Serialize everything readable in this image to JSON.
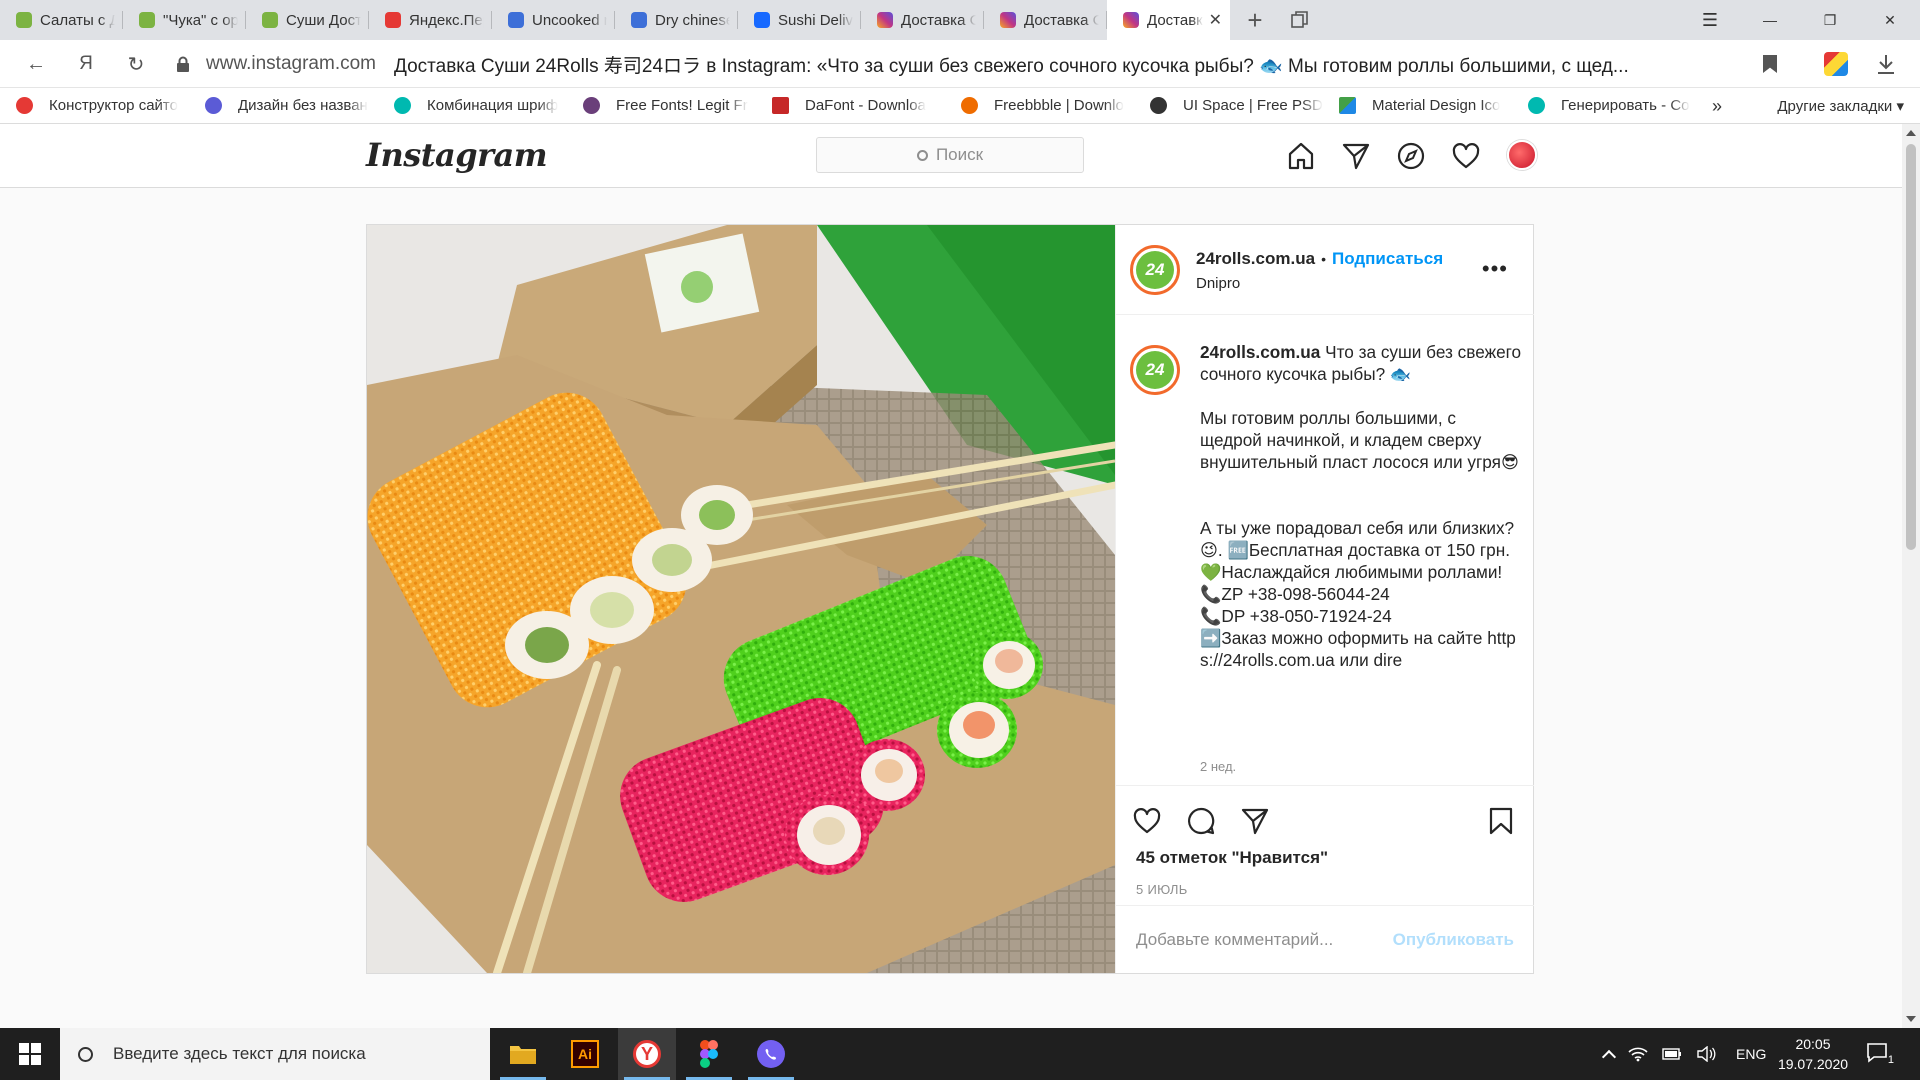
{
  "browser": {
    "tabs": [
      {
        "title": "Салаты с Дос",
        "color": "#7cb342"
      },
      {
        "title": "\"Чука\" с орех",
        "color": "#7cb342"
      },
      {
        "title": "Суши Достав",
        "color": "#7cb342"
      },
      {
        "title": "Яндекс.Перев",
        "color": "#e53935"
      },
      {
        "title": "Uncooked nes",
        "color": "#3d6fd8"
      },
      {
        "title": "Dry chinese n",
        "color": "#3d6fd8"
      },
      {
        "title": "Sushi Delivery",
        "color": "#1769ff"
      },
      {
        "title": "Доставка Сус",
        "color": "#c13584"
      },
      {
        "title": "Доставка Сус",
        "color": "#c13584"
      },
      {
        "title": "Доставка С",
        "color": "#c13584"
      }
    ],
    "tab_close": "✕",
    "new_tab": "+",
    "window": {
      "minimize": "—",
      "restore": "❐",
      "close": "✕",
      "menu": "☰"
    },
    "nav": {
      "back": "←",
      "yandex": "Я",
      "reload": "↻"
    },
    "address": {
      "host": "www.instagram.com",
      "title": "Доставка Суши 24Rolls 寿司24ロラ в Instagram: «Что за суши без свежего сочного кусочка рыбы? 🐟   Мы готовим роллы большими, с щед..."
    },
    "bookmarks": [
      {
        "label": "Конструктор сайто",
        "color": "#e53935"
      },
      {
        "label": "Дизайн без назван",
        "color": "#5b5bd6"
      },
      {
        "label": "Комбинация шриф",
        "color": "#00b9b0"
      },
      {
        "label": "Free Fonts! Legit Fr",
        "color": "#6a3f7a"
      },
      {
        "label": "DaFont - Downloa",
        "color": "#c62828"
      },
      {
        "label": "Freebbble | Downlo",
        "color": "#ef6c00"
      },
      {
        "label": "UI Space | Free PSD",
        "color": "#333333"
      },
      {
        "label": "Material Design Ico",
        "color": "#43a047"
      },
      {
        "label": "Генерировать - Co",
        "color": "#00b9b0"
      }
    ],
    "bookmarks_more": "»",
    "bookmarks_other": "Другие закладки ▾"
  },
  "instagram": {
    "logo": "Instagram",
    "search_placeholder": "Поиск",
    "icons": [
      "home-icon",
      "direct-icon",
      "explore-icon",
      "activity-heart-icon",
      "profile-avatar"
    ]
  },
  "post": {
    "account": "24rolls.com.ua",
    "bullet": "•",
    "follow": "Подписаться",
    "location": "Dnipro",
    "logo_text": "24",
    "more": "•••",
    "caption_user": "24rolls.com.ua",
    "caption_lines": {
      "l1": " Что за суши без свежего сочного кусочка рыбы? 🐟",
      "l2": "Мы готовим роллы большими, с щедрой начинкой, и кладем сверху внушительный пласт лосося или угря😎",
      "l3": "А ты уже порадовал себя или близких?😉. 🆓Бесплатная доставка от 150 грн.",
      "l4": "💚Наслаждайся любимыми роллами!",
      "l5": "📞ZP +38-098-56044-24",
      "l6": "📞DP +38-050-71924-24",
      "l7": "➡️Заказ можно оформить на сайте https://24rolls.com.ua или dire"
    },
    "ago": "2 нед.",
    "likes": "45 отметок \"Нравится\"",
    "date": "5 ИЮЛЬ",
    "comment_placeholder": "Добавьте комментарий...",
    "publish": "Опубликовать"
  },
  "taskbar": {
    "search_placeholder": "Введите здесь текст для поиска",
    "apps": [
      "file-explorer",
      "illustrator",
      "yandex-browser",
      "figma",
      "viber"
    ],
    "illustrator_label": "Ai",
    "yandex_label": "Y",
    "lang": "ENG",
    "time": "20:05",
    "date": "19.07.2020",
    "notification_count": "1"
  },
  "colors": {
    "link": "#0095f6",
    "brand_orange": "#f26a2c",
    "brand_green": "#6cbf3f"
  }
}
